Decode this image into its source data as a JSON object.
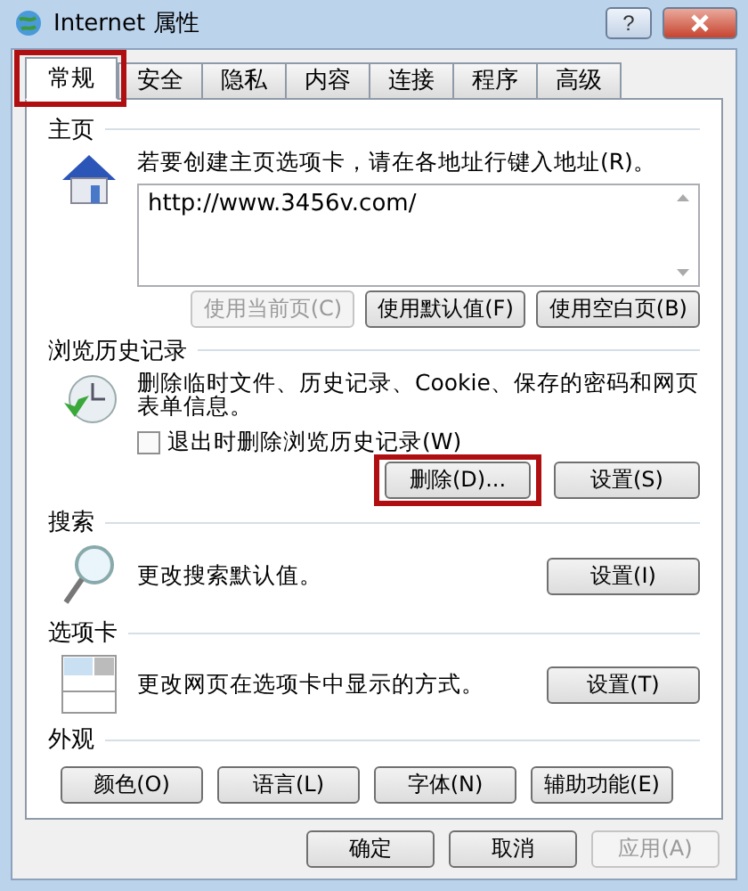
{
  "window": {
    "title": "Internet 属性",
    "help": "?"
  },
  "tabs": [
    {
      "label": "常规",
      "selected": true,
      "highlighted": true
    },
    {
      "label": "安全",
      "selected": false,
      "highlighted": false
    },
    {
      "label": "隐私",
      "selected": false,
      "highlighted": false
    },
    {
      "label": "内容",
      "selected": false,
      "highlighted": false
    },
    {
      "label": "连接",
      "selected": false,
      "highlighted": false
    },
    {
      "label": "程序",
      "selected": false,
      "highlighted": false
    },
    {
      "label": "高级",
      "selected": false,
      "highlighted": false
    }
  ],
  "sections": [
    {
      "kind": "home",
      "title": "主页",
      "description": "若要创建主页选项卡，请在各地址行键入地址(R)。",
      "url": "http://www.3456v.com/",
      "buttons": [
        {
          "label": "使用当前页(C)",
          "disabled": true,
          "highlighted": false
        },
        {
          "label": "使用默认值(F)",
          "disabled": false,
          "highlighted": false
        },
        {
          "label": "使用空白页(B)",
          "disabled": false,
          "highlighted": false
        }
      ]
    },
    {
      "kind": "history",
      "title": "浏览历史记录",
      "description": "删除临时文件、历史记录、Cookie、保存的密码和网页表单信息。",
      "checkbox": {
        "label": "退出时删除浏览历史记录(W)",
        "checked": false
      },
      "buttons": [
        {
          "label": "删除(D)...",
          "disabled": false,
          "highlighted": true
        },
        {
          "label": "设置(S)",
          "disabled": false,
          "highlighted": false
        }
      ]
    },
    {
      "kind": "search",
      "title": "搜索",
      "description": "更改搜索默认值。",
      "buttons": [
        {
          "label": "设置(I)",
          "disabled": false,
          "highlighted": false
        }
      ]
    },
    {
      "kind": "tabs",
      "title": "选项卡",
      "description": "更改网页在选项卡中显示的方式。",
      "buttons": [
        {
          "label": "设置(T)",
          "disabled": false,
          "highlighted": false
        }
      ]
    },
    {
      "kind": "appearance",
      "title": "外观",
      "buttons": [
        {
          "label": "颜色(O)",
          "disabled": false,
          "highlighted": false
        },
        {
          "label": "语言(L)",
          "disabled": false,
          "highlighted": false
        },
        {
          "label": "字体(N)",
          "disabled": false,
          "highlighted": false
        },
        {
          "label": "辅助功能(E)",
          "disabled": false,
          "highlighted": false
        }
      ]
    }
  ],
  "footer": [
    {
      "label": "确定",
      "disabled": false
    },
    {
      "label": "取消",
      "disabled": false
    },
    {
      "label": "应用(A)",
      "disabled": true
    }
  ]
}
